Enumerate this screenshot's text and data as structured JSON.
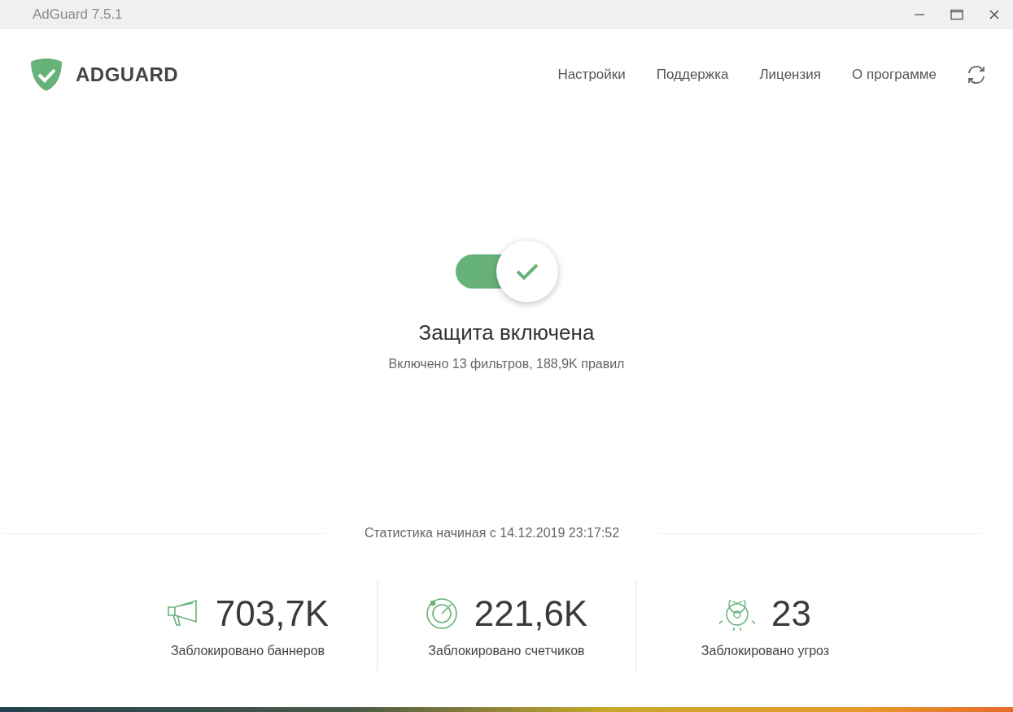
{
  "window": {
    "title": "AdGuard 7.5.1"
  },
  "header": {
    "brand": "ADGUARD",
    "nav": [
      "Настройки",
      "Поддержка",
      "Лицензия",
      "О программе"
    ]
  },
  "protection": {
    "on": true,
    "title": "Защита включена",
    "subtitle": "Включено 13 фильтров, 188,9K правил"
  },
  "statistics": {
    "since": "Статистика начиная с 14.12.2019 23:17:52",
    "items": [
      {
        "kind": "banners",
        "value": "703,7K",
        "label": "Заблокировано баннеров"
      },
      {
        "kind": "trackers",
        "value": "221,6K",
        "label": "Заблокировано счетчиков"
      },
      {
        "kind": "threats",
        "value": "23",
        "label": "Заблокировано угроз"
      }
    ]
  }
}
